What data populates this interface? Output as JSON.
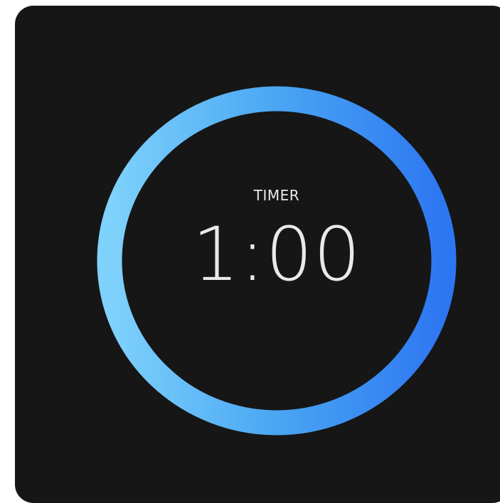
{
  "timer": {
    "label": "TIMER",
    "time": "1:00",
    "progress": 1.0
  },
  "colors": {
    "background": "#161616",
    "ring_start": "#7fd2fb",
    "ring_mid": "#4aa6f3",
    "ring_end": "#2d76f2",
    "text": "#e9e9e9"
  }
}
